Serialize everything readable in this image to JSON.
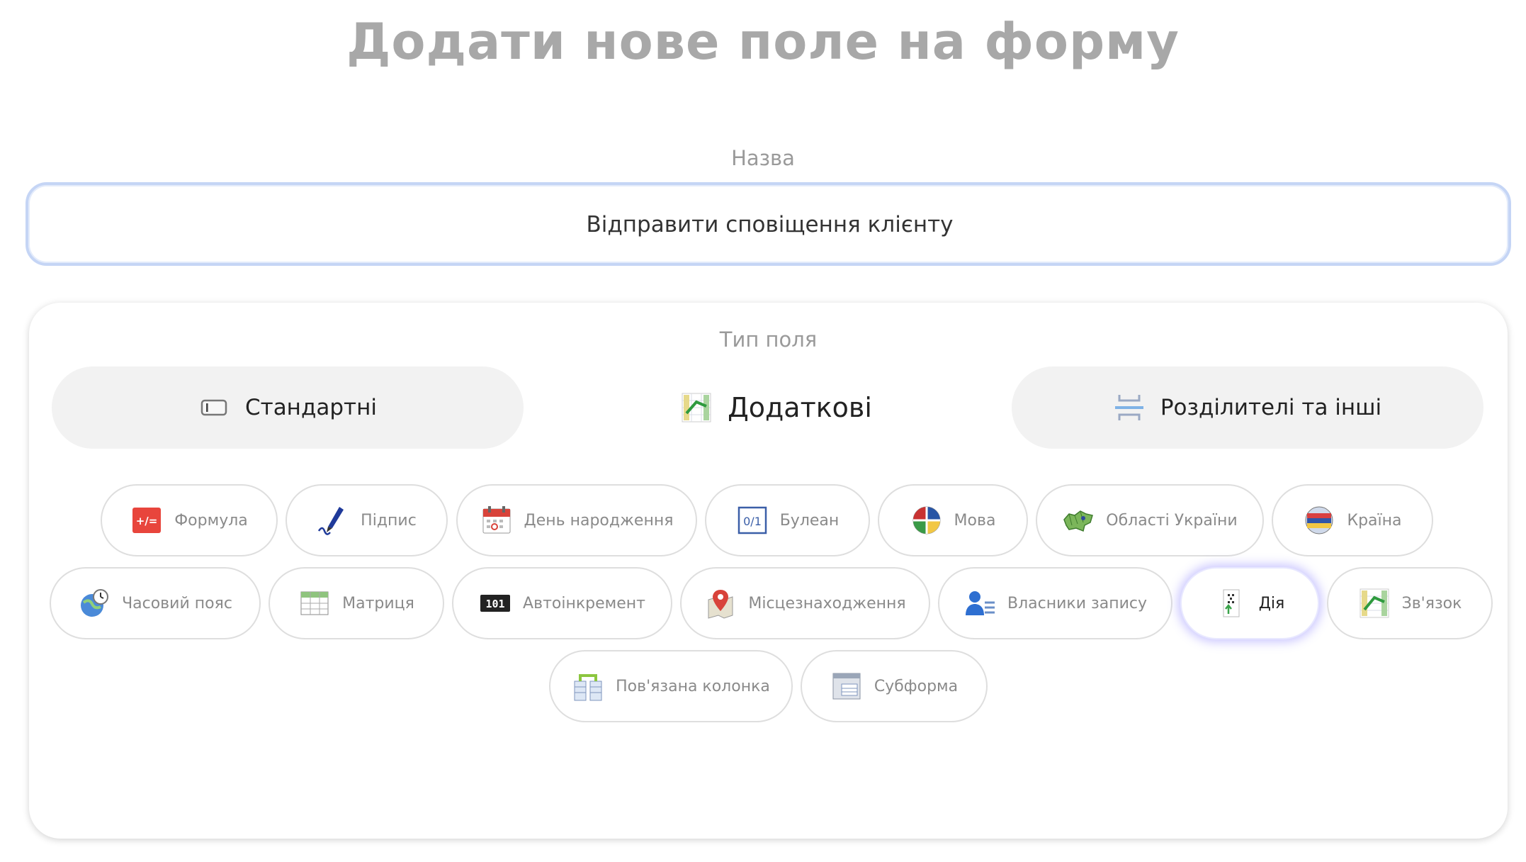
{
  "page": {
    "title": "Додати нове поле на форму"
  },
  "name_field": {
    "label": "Назва",
    "value": "Відправити сповіщення клієнту"
  },
  "field_type": {
    "label": "Тип поля",
    "tabs": [
      {
        "label": "Стандартні",
        "icon": "text-field-icon",
        "active": false
      },
      {
        "label": "Додаткові",
        "icon": "relation-chart-icon",
        "active": true
      },
      {
        "label": "Розділителі та інші",
        "icon": "divider-icon",
        "active": false
      }
    ],
    "chips": [
      {
        "label": "Формула",
        "icon": "formula-icon",
        "selected": false
      },
      {
        "label": "Підпис",
        "icon": "signature-pen-icon",
        "selected": false
      },
      {
        "label": "День народження",
        "icon": "calendar-icon",
        "selected": false
      },
      {
        "label": "Булеан",
        "icon": "boolean-icon",
        "selected": false
      },
      {
        "label": "Мова",
        "icon": "language-flags-icon",
        "selected": false
      },
      {
        "label": "Області України",
        "icon": "ukraine-map-icon",
        "selected": false
      },
      {
        "label": "Країна",
        "icon": "country-flag-icon",
        "selected": false
      },
      {
        "label": "Часовий пояс",
        "icon": "timezone-globe-icon",
        "selected": false
      },
      {
        "label": "Матриця",
        "icon": "matrix-table-icon",
        "selected": false
      },
      {
        "label": "Автоінкремент",
        "icon": "counter-icon",
        "selected": false
      },
      {
        "label": "Місцезнаходження",
        "icon": "map-pin-icon",
        "selected": false
      },
      {
        "label": "Власники запису",
        "icon": "record-owner-icon",
        "selected": false
      },
      {
        "label": "Дія",
        "icon": "action-icon",
        "selected": true
      },
      {
        "label": "Зв'язок",
        "icon": "relation-chart-icon",
        "selected": false
      },
      {
        "label": "Пов'язана колонка",
        "icon": "linked-column-icon",
        "selected": false
      },
      {
        "label": "Субформа",
        "icon": "subform-icon",
        "selected": false
      }
    ]
  },
  "colors": {
    "title": "#a8a8a8",
    "input_border": "#c5d5f5",
    "tab_inactive_bg": "#f2f2f2",
    "chip_border": "#dedede",
    "selected_glow": "#8c82ff"
  }
}
